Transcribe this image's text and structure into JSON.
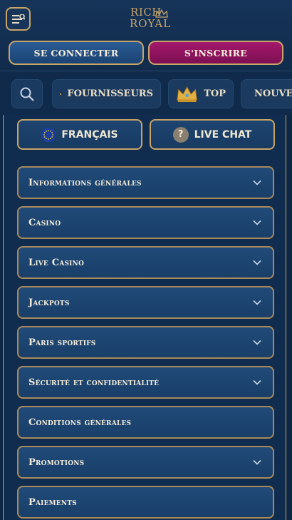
{
  "header": {
    "logo_line1": "RICH",
    "logo_line2": "ROYAL",
    "login_label": "SE CONNECTER",
    "register_label": "S'INSCRIRE"
  },
  "nav": {
    "providers_label": "FOURNISSEURS",
    "top_label": "TOP",
    "new_label": "NOUVEAUX"
  },
  "quick": {
    "language_label": "FRANÇAIS",
    "chat_label": "LIVE CHAT"
  },
  "sections": [
    {
      "label": "Informations générales",
      "expandable": true
    },
    {
      "label": "Casino",
      "expandable": true
    },
    {
      "label": "Live Casino",
      "expandable": true
    },
    {
      "label": "Jackpots",
      "expandable": true
    },
    {
      "label": "Paris sportifs",
      "expandable": true
    },
    {
      "label": "Sécurité et confidentialité",
      "expandable": true
    },
    {
      "label": "Conditions générales",
      "expandable": false
    },
    {
      "label": "Promotions",
      "expandable": true
    },
    {
      "label": "Paiements",
      "expandable": false
    }
  ],
  "colors": {
    "background": "#0d2744",
    "gold": "#c9a468",
    "login": "#2a5b93",
    "register": "#a3186c"
  }
}
